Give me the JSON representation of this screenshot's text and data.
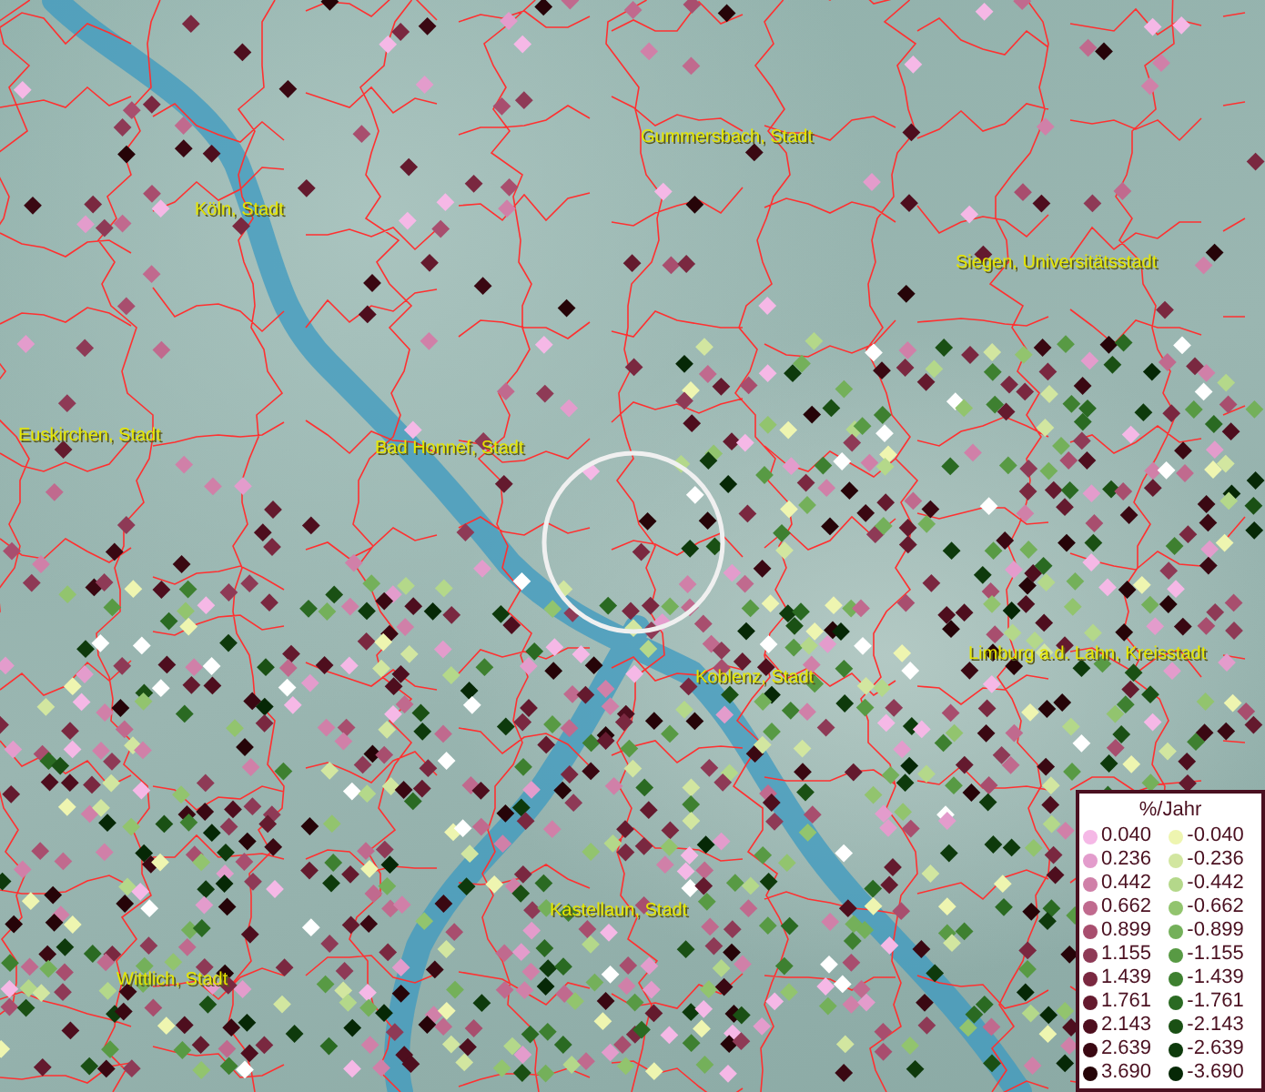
{
  "places": [
    {
      "name": "Gummersbach, Stadt"
    },
    {
      "name": "Köln, Stadt"
    },
    {
      "name": "Siegen, Universitätsstadt"
    },
    {
      "name": "Euskirchen, Stadt"
    },
    {
      "name": "Bad Honnef, Stadt"
    },
    {
      "name": "Limburg a.d. Lahn, Kreisstadt"
    },
    {
      "name": "Koblenz, Stadt"
    },
    {
      "name": "Kastellaun, Stadt"
    },
    {
      "name": "Wittlich, Stadt"
    }
  ],
  "legend": {
    "title": "%/Jahr",
    "items": [
      {
        "label": "0.040",
        "color": "#f5b8e6"
      },
      {
        "label": "-0.040",
        "color": "#eef5b0"
      },
      {
        "label": "0.236",
        "color": "#e39ccc"
      },
      {
        "label": "-0.236",
        "color": "#d2e6a0"
      },
      {
        "label": "0.442",
        "color": "#d080a8"
      },
      {
        "label": "-0.442",
        "color": "#b4d88a"
      },
      {
        "label": "0.662",
        "color": "#c06a8e"
      },
      {
        "label": "-0.662",
        "color": "#92c46e"
      },
      {
        "label": "0.899",
        "color": "#a84e6e"
      },
      {
        "label": "-0.899",
        "color": "#74b05a"
      },
      {
        "label": "1.155",
        "color": "#8e3a56"
      },
      {
        "label": "-1.155",
        "color": "#589a44"
      },
      {
        "label": "1.439",
        "color": "#7a2840"
      },
      {
        "label": "-1.439",
        "color": "#3e8030"
      },
      {
        "label": "1.761",
        "color": "#641a2e"
      },
      {
        "label": "-1.761",
        "color": "#2a6a22"
      },
      {
        "label": "2.143",
        "color": "#4e0e1e"
      },
      {
        "label": "-2.143",
        "color": "#1a5014"
      },
      {
        "label": "2.639",
        "color": "#3a0812"
      },
      {
        "label": "-2.639",
        "color": "#0e3a0c"
      },
      {
        "label": "3.690",
        "color": "#260408"
      },
      {
        "label": "-3.690",
        "color": "#062806"
      }
    ]
  }
}
